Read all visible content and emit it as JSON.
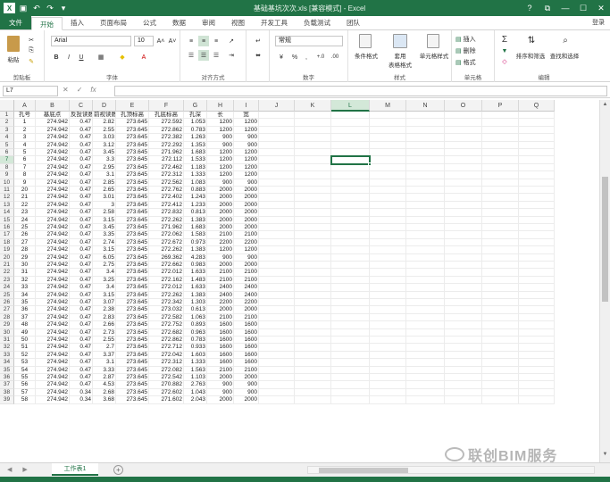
{
  "window": {
    "title": "基础基坑次次.xls  [兼容模式] - Excel",
    "controls": [
      "?",
      "⧉",
      "—",
      "☐",
      "✕"
    ]
  },
  "qat": {
    "logo": "X",
    "items": [
      "save-icon",
      "undo-icon",
      "redo-icon"
    ]
  },
  "tabs": [
    "文件",
    "开始",
    "插入",
    "页面布局",
    "公式",
    "数据",
    "审阅",
    "视图",
    "开发工具",
    "负载测试",
    "团队"
  ],
  "active_tab": "开始",
  "login": "登录",
  "ribbon": {
    "clipboard": {
      "label": "剪贴板",
      "paste": "粘贴"
    },
    "font": {
      "label": "字体",
      "name": "Arial",
      "size": "10",
      "bold": "B",
      "italic": "I",
      "underline": "U",
      "grow": "A˄",
      "shrink": "A˅"
    },
    "alignment": {
      "label": "对齐方式"
    },
    "number": {
      "label": "数字",
      "format": "常规",
      "percent": "%",
      "comma": ","
    },
    "styles": {
      "label": "样式",
      "conditional": "条件格式",
      "table": "套用\n表格格式",
      "cell": "单元格样式"
    },
    "cells": {
      "label": "单元格",
      "insert": "插入",
      "delete": "删除",
      "format": "格式"
    },
    "editing": {
      "label": "编辑",
      "sum": "Σ",
      "sort": "排序和筛选",
      "find": "查找和选择"
    }
  },
  "formula_bar": {
    "name_box": "L7",
    "cancel": "✕",
    "enter": "✓",
    "fx": "fx",
    "value": ""
  },
  "grid": {
    "columns": [
      "A",
      "B",
      "C",
      "D",
      "E",
      "F",
      "G",
      "H",
      "I",
      "J",
      "K",
      "L",
      "M",
      "N",
      "O",
      "P",
      "Q"
    ],
    "selected_column": "L",
    "selected_row": "7",
    "header_row": [
      "孔号",
      "基底点",
      "反投读数",
      "前视读数",
      "孔顶标高",
      "孔底标高",
      "孔深",
      "长",
      "宽"
    ],
    "rows": [
      [
        "1",
        "274.942",
        "0.47",
        "2.82",
        "273.645",
        "272.592",
        "1.053",
        "1200",
        "1200"
      ],
      [
        "2",
        "274.942",
        "0.47",
        "2.55",
        "273.645",
        "272.862",
        "0.783",
        "1200",
        "1200"
      ],
      [
        "3",
        "274.942",
        "0.47",
        "3.03",
        "273.645",
        "272.382",
        "1.263",
        "900",
        "900"
      ],
      [
        "4",
        "274.942",
        "0.47",
        "3.12",
        "273.645",
        "272.292",
        "1.353",
        "900",
        "900"
      ],
      [
        "5",
        "274.942",
        "0.47",
        "3.45",
        "273.645",
        "271.962",
        "1.683",
        "1200",
        "1200"
      ],
      [
        "6",
        "274.942",
        "0.47",
        "3.3",
        "273.645",
        "272.112",
        "1.533",
        "1200",
        "1200"
      ],
      [
        "7",
        "274.942",
        "0.47",
        "2.95",
        "273.645",
        "272.462",
        "1.183",
        "1200",
        "1200"
      ],
      [
        "8",
        "274.942",
        "0.47",
        "3.1",
        "273.645",
        "272.312",
        "1.333",
        "1200",
        "1200"
      ],
      [
        "9",
        "274.942",
        "0.47",
        "2.85",
        "273.645",
        "272.562",
        "1.083",
        "900",
        "900"
      ],
      [
        "20",
        "274.942",
        "0.47",
        "2.65",
        "273.645",
        "272.762",
        "0.883",
        "2000",
        "2000"
      ],
      [
        "21",
        "274.942",
        "0.47",
        "3.01",
        "273.645",
        "272.402",
        "1.243",
        "2000",
        "2000"
      ],
      [
        "22",
        "274.942",
        "0.47",
        "3",
        "273.645",
        "272.412",
        "1.233",
        "2000",
        "2000"
      ],
      [
        "23",
        "274.942",
        "0.47",
        "2.58",
        "273.645",
        "272.832",
        "0.813",
        "2000",
        "2000"
      ],
      [
        "24",
        "274.942",
        "0.47",
        "3.15",
        "273.645",
        "272.262",
        "1.383",
        "2000",
        "2000"
      ],
      [
        "25",
        "274.942",
        "0.47",
        "3.45",
        "273.645",
        "271.962",
        "1.683",
        "2000",
        "2000"
      ],
      [
        "26",
        "274.942",
        "0.47",
        "3.35",
        "273.645",
        "272.062",
        "1.583",
        "2100",
        "2100"
      ],
      [
        "27",
        "274.942",
        "0.47",
        "2.74",
        "273.645",
        "272.672",
        "0.973",
        "2200",
        "2200"
      ],
      [
        "28",
        "274.942",
        "0.47",
        "3.15",
        "273.645",
        "272.262",
        "1.383",
        "1200",
        "1200"
      ],
      [
        "29",
        "274.942",
        "0.47",
        "6.05",
        "273.645",
        "269.362",
        "4.283",
        "900",
        "900"
      ],
      [
        "30",
        "274.942",
        "0.47",
        "2.75",
        "273.645",
        "272.662",
        "0.983",
        "2000",
        "2000"
      ],
      [
        "31",
        "274.942",
        "0.47",
        "3.4",
        "273.645",
        "272.012",
        "1.633",
        "2100",
        "2100"
      ],
      [
        "32",
        "274.942",
        "0.47",
        "3.25",
        "273.645",
        "272.162",
        "1.483",
        "2100",
        "2100"
      ],
      [
        "33",
        "274.942",
        "0.47",
        "3.4",
        "273.645",
        "272.012",
        "1.633",
        "2400",
        "2400"
      ],
      [
        "34",
        "274.942",
        "0.47",
        "3.15",
        "273.645",
        "272.262",
        "1.383",
        "2400",
        "2400"
      ],
      [
        "35",
        "274.942",
        "0.47",
        "3.07",
        "273.645",
        "272.342",
        "1.303",
        "2200",
        "2200"
      ],
      [
        "36",
        "274.942",
        "0.47",
        "2.38",
        "273.645",
        "273.032",
        "0.613",
        "2000",
        "2000"
      ],
      [
        "37",
        "274.942",
        "0.47",
        "2.83",
        "273.645",
        "272.582",
        "1.063",
        "2100",
        "2100"
      ],
      [
        "48",
        "274.942",
        "0.47",
        "2.66",
        "273.645",
        "272.752",
        "0.893",
        "1600",
        "1600"
      ],
      [
        "49",
        "274.942",
        "0.47",
        "2.73",
        "273.645",
        "272.682",
        "0.963",
        "1600",
        "1600"
      ],
      [
        "50",
        "274.942",
        "0.47",
        "2.55",
        "273.645",
        "272.862",
        "0.783",
        "1600",
        "1600"
      ],
      [
        "51",
        "274.942",
        "0.47",
        "2.7",
        "273.645",
        "272.712",
        "0.933",
        "1600",
        "1600"
      ],
      [
        "52",
        "274.942",
        "0.47",
        "3.37",
        "273.645",
        "272.042",
        "1.603",
        "1600",
        "1600"
      ],
      [
        "53",
        "274.942",
        "0.47",
        "3.1",
        "273.645",
        "272.312",
        "1.333",
        "1600",
        "1600"
      ],
      [
        "54",
        "274.942",
        "0.47",
        "3.33",
        "273.645",
        "272.082",
        "1.563",
        "2100",
        "2100"
      ],
      [
        "55",
        "274.942",
        "0.47",
        "2.87",
        "273.645",
        "272.542",
        "1.103",
        "2000",
        "2000"
      ],
      [
        "56",
        "274.942",
        "0.47",
        "4.53",
        "273.645",
        "270.882",
        "2.763",
        "900",
        "900"
      ],
      [
        "57",
        "274.942",
        "0.34",
        "2.68",
        "273.645",
        "272.602",
        "1.043",
        "900",
        "900"
      ],
      [
        "58",
        "274.942",
        "0.34",
        "3.68",
        "273.645",
        "271.602",
        "2.043",
        "2000",
        "2000"
      ]
    ]
  },
  "sheets": {
    "tabs": [
      "工作表1"
    ],
    "add": "+"
  },
  "watermark": "联创BIM服务"
}
